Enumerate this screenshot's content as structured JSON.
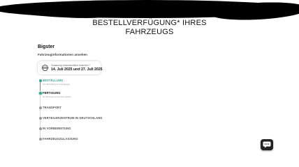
{
  "header": {
    "title_line1": "BESTELLVERFÜGUNG* IHRES",
    "title_line2": "FAHRZEUGS"
  },
  "vehicle": {
    "model": "Bigster",
    "info_link": "Fahrzeuginformationen ansehen"
  },
  "delivery": {
    "label": "Zulassung voraussichtlich zwischen *",
    "dates": "14. Juli 2025 und 27. Juli 2025",
    "icon": "car-delivery-icon"
  },
  "timeline": {
    "steps": [
      {
        "label": "BESTELLUNG",
        "sub": "Ihre Bestellung ist eingegangen",
        "state": "done"
      },
      {
        "label": "FERTIGUNG",
        "sub": "Ihr Fahrzeug wird gerade gebaut",
        "state": "current"
      },
      {
        "label": "TRANSPORT",
        "sub": "",
        "state": "pending"
      },
      {
        "label": "VERTEILERZENTRUM IN DEUTSCHLAND",
        "sub": "",
        "state": "pending"
      },
      {
        "label": "IN VORBEREITUNG",
        "sub": "",
        "state": "pending"
      },
      {
        "label": "FAHRZEUGZULASSUNG",
        "sub": "",
        "state": "pending"
      }
    ]
  },
  "chat": {
    "icon": "chat-icon"
  },
  "colors": {
    "accent": "#37a391",
    "text": "#111111",
    "pending": "#9a9a9a"
  }
}
